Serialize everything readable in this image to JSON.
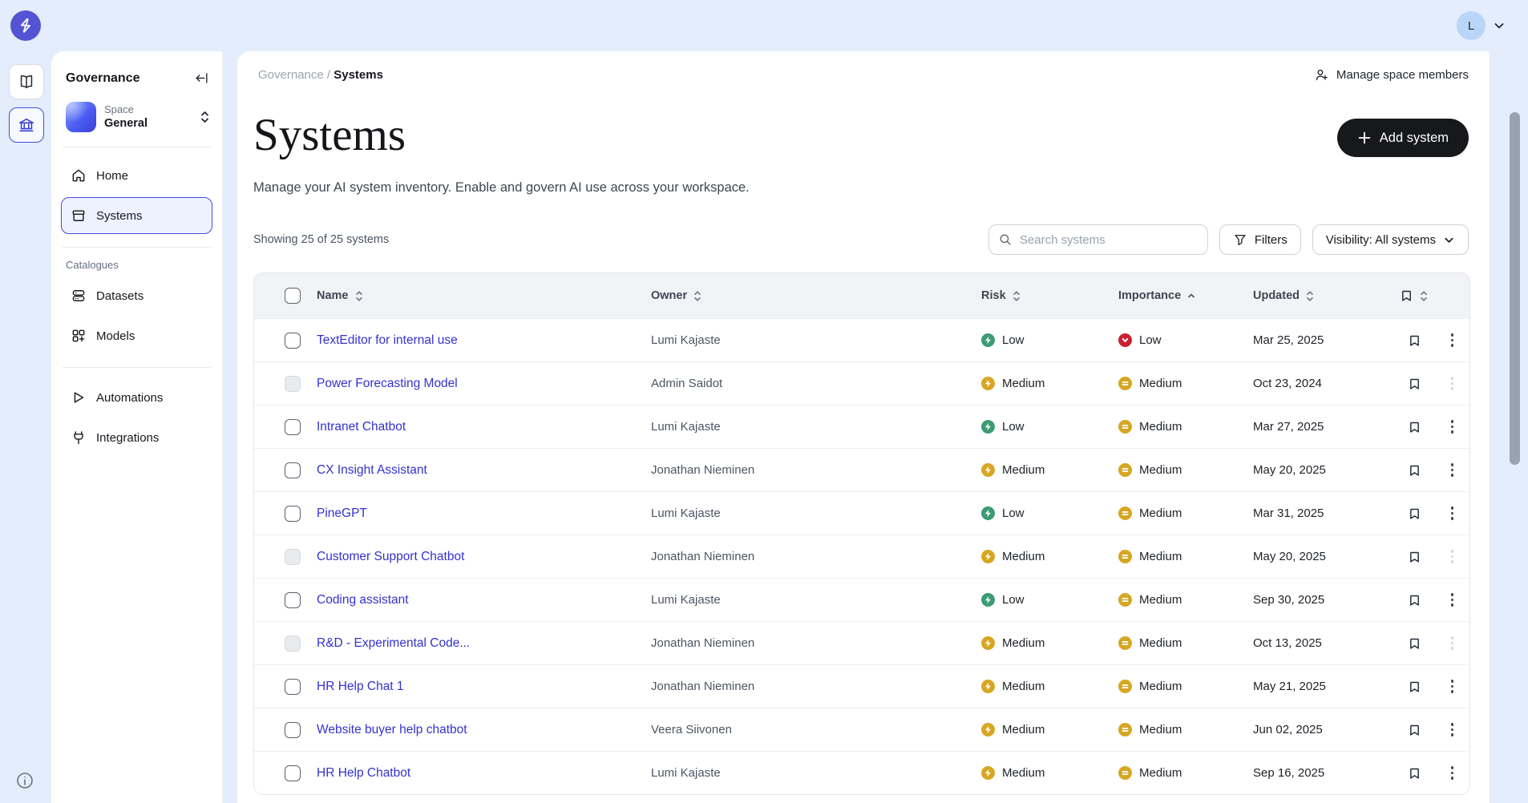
{
  "topbar": {
    "avatar_initial": "L"
  },
  "sidebar": {
    "title": "Governance",
    "space": {
      "label": "Space",
      "name": "General"
    },
    "nav": {
      "home": "Home",
      "systems": "Systems",
      "catalogues_label": "Catalogues",
      "datasets": "Datasets",
      "models": "Models",
      "automations": "Automations",
      "integrations": "Integrations"
    }
  },
  "breadcrumb": {
    "parent": "Governance",
    "separator": "/",
    "current": "Systems"
  },
  "header_actions": {
    "manage_members": "Manage space members"
  },
  "page": {
    "title": "Systems",
    "description": "Manage your AI system inventory. Enable and govern AI use across your workspace.",
    "add_button": "Add system",
    "showing": "Showing 25 of 25 systems"
  },
  "toolbar": {
    "search_placeholder": "Search systems",
    "filters": "Filters",
    "visibility": "Visibility: All systems"
  },
  "table": {
    "columns": {
      "name": "Name",
      "owner": "Owner",
      "risk": "Risk",
      "importance": "Importance",
      "updated": "Updated"
    },
    "sort": {
      "importance": "asc"
    },
    "rows": [
      {
        "name": "TextEditor for internal use",
        "owner": "Lumi Kajaste",
        "risk": "Low",
        "importance": "Low",
        "updated": "Mar 25, 2025",
        "selectable": true
      },
      {
        "name": "Power Forecasting Model",
        "owner": "Admin Saidot",
        "risk": "Medium",
        "importance": "Medium",
        "updated": "Oct 23, 2024",
        "selectable": false
      },
      {
        "name": "Intranet Chatbot",
        "owner": "Lumi Kajaste",
        "risk": "Low",
        "importance": "Medium",
        "updated": "Mar 27, 2025",
        "selectable": true
      },
      {
        "name": "CX Insight Assistant",
        "owner": "Jonathan Nieminen",
        "risk": "Medium",
        "importance": "Medium",
        "updated": "May 20, 2025",
        "selectable": true
      },
      {
        "name": "PineGPT",
        "owner": "Lumi Kajaste",
        "risk": "Low",
        "importance": "Medium",
        "updated": "Mar 31, 2025",
        "selectable": true
      },
      {
        "name": "Customer Support Chatbot",
        "owner": "Jonathan Nieminen",
        "risk": "Medium",
        "importance": "Medium",
        "updated": "May 20, 2025",
        "selectable": false
      },
      {
        "name": "Coding assistant",
        "owner": "Lumi Kajaste",
        "risk": "Low",
        "importance": "Medium",
        "updated": "Sep 30, 2025",
        "selectable": true
      },
      {
        "name": "R&D - Experimental Code...",
        "owner": "Jonathan Nieminen",
        "risk": "Medium",
        "importance": "Medium",
        "updated": "Oct 13, 2025",
        "selectable": false
      },
      {
        "name": "HR Help Chat 1",
        "owner": "Jonathan Nieminen",
        "risk": "Medium",
        "importance": "Medium",
        "updated": "May 21, 2025",
        "selectable": true
      },
      {
        "name": "Website buyer help chatbot",
        "owner": "Veera Siivonen",
        "risk": "Medium",
        "importance": "Medium",
        "updated": "Jun 02, 2025",
        "selectable": true
      },
      {
        "name": "HR Help Chatbot",
        "owner": "Lumi Kajaste",
        "risk": "Medium",
        "importance": "Medium",
        "updated": "Sep 16, 2025",
        "selectable": true
      }
    ]
  },
  "colors": {
    "accent": "#474be0",
    "link": "#3432cf",
    "brand": "#5453d4",
    "risk": {
      "Low": "#3b9c74",
      "Medium": "#d7a623"
    },
    "importance": {
      "Low": "#cb2030",
      "Medium": "#d7a623"
    }
  }
}
